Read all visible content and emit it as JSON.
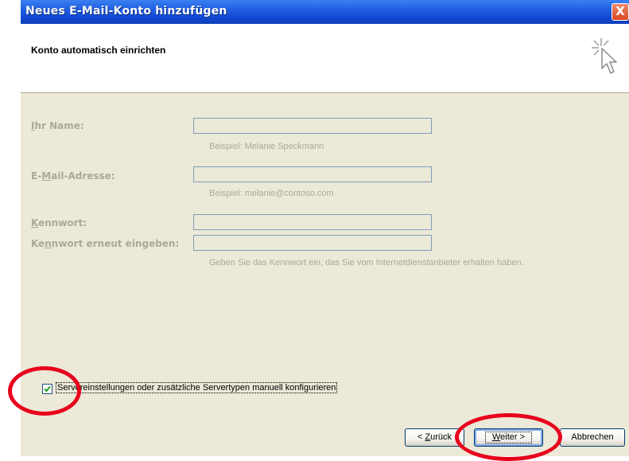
{
  "window": {
    "title": "Neues E-Mail-Konto hinzufügen",
    "close_glyph": "X"
  },
  "header": {
    "title": "Konto automatisch einrichten",
    "icon": "wizard-cursor-icon"
  },
  "form": {
    "name_label_underlined": "I",
    "name_label_rest": "hr Name:",
    "name_value": "",
    "name_hint": "Beispiel: Melanie Speckmann",
    "email_label_pre": "E-",
    "email_label_underlined": "M",
    "email_label_rest": "ail-Adresse:",
    "email_value": "",
    "email_hint": "Beispiel: melanie@contoso.com",
    "password_label_underlined": "K",
    "password_label_rest": "ennwort:",
    "password_value": "",
    "password_confirm_label_pre": "Ke",
    "password_confirm_label_underlined": "n",
    "password_confirm_label_rest": "nwort erneut eingeben:",
    "password_confirm_value": "",
    "password_hint": "Geben Sie das Kennwort ein, das Sie vom Internetdienstanbieter erhalten haben."
  },
  "manual_config": {
    "checked": true,
    "label": "Servereinstellungen oder zusätzliche Servertypen manuell konfigurieren"
  },
  "buttons": {
    "back_pre": "< ",
    "back_underlined": "Z",
    "back_rest": "urück",
    "next_underlined": "W",
    "next_rest": "eiter >",
    "cancel": "Abbrechen"
  },
  "colors": {
    "annotation": "#e8001c",
    "titlebar": "#1f5fe0",
    "dialog_background": "#ece9d8"
  }
}
